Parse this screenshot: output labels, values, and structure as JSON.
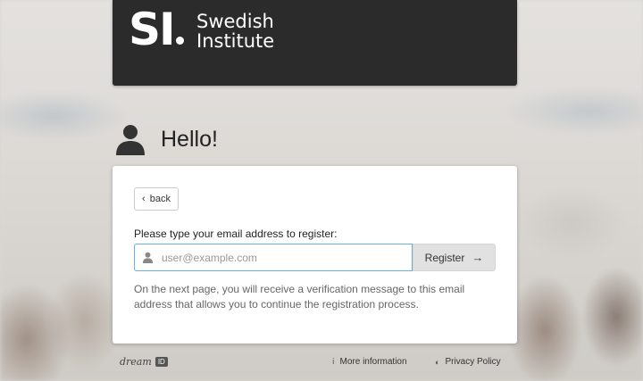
{
  "brand": {
    "logo_mark": "SI",
    "name_line1": "Swedish",
    "name_line2": "Institute"
  },
  "greeting": "Hello!",
  "form": {
    "back_label": "back",
    "prompt": "Please type your email address to register:",
    "email_placeholder": "user@example.com",
    "email_value": "",
    "register_label": "Register",
    "help_text": "On the next page, you will receive a verification message to this email address that allows you to continue the registration process."
  },
  "footer": {
    "brand_text": "dream",
    "brand_badge": "ID",
    "more_info_label": "More information",
    "privacy_label": "Privacy Policy"
  },
  "colors": {
    "banner": "#2b2b2b",
    "input_focus_border": "#66afe9",
    "register_button_bg": "#e1e1e1"
  },
  "icons": [
    "user-icon",
    "chevron-left-icon",
    "arrow-right-icon",
    "info-icon",
    "shield-icon"
  ]
}
